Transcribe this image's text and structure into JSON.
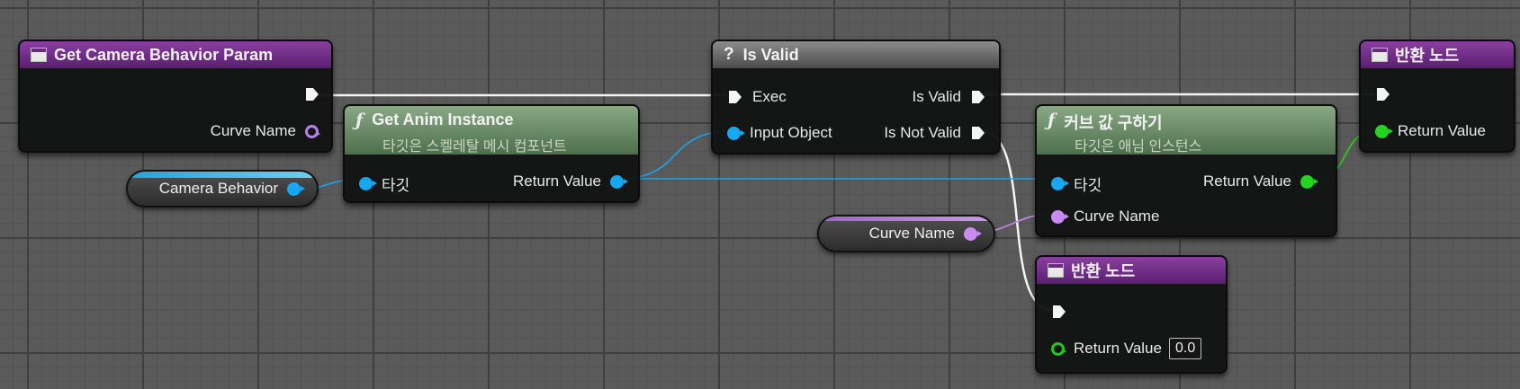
{
  "nodes": {
    "get_camera_behavior_param": {
      "title": "Get Camera Behavior Param",
      "out_curve_name": "Curve Name"
    },
    "get_anim_instance": {
      "title": "Get Anim Instance",
      "subtitle": "타깃은 스켈레탈 메시 컴포넌트",
      "in_target": "타깃",
      "out_return": "Return Value"
    },
    "is_valid": {
      "title": "Is Valid",
      "in_exec": "Exec",
      "in_object": "Input Object",
      "out_valid": "Is Valid",
      "out_not_valid": "Is Not Valid"
    },
    "get_curve_value": {
      "title": "커브 값 구하기",
      "subtitle": "타깃은 애님 인스턴스",
      "in_target": "타깃",
      "in_curve_name": "Curve Name",
      "out_return": "Return Value"
    },
    "return_node_top": {
      "title": "반환 노드",
      "in_return": "Return Value"
    },
    "return_node_bottom": {
      "title": "반환 노드",
      "in_return": "Return Value",
      "default_value": "0.0"
    }
  },
  "variables": {
    "camera_behavior": "Camera Behavior",
    "curve_name": "Curve Name"
  },
  "colors": {
    "exec_wire": "#ffffff",
    "object_wire": "#17a6f0",
    "name_wire": "#c98bf2",
    "float_wire": "#25d41e",
    "purple_header": "#8a3fa0",
    "green_header": "#6b8a67"
  }
}
